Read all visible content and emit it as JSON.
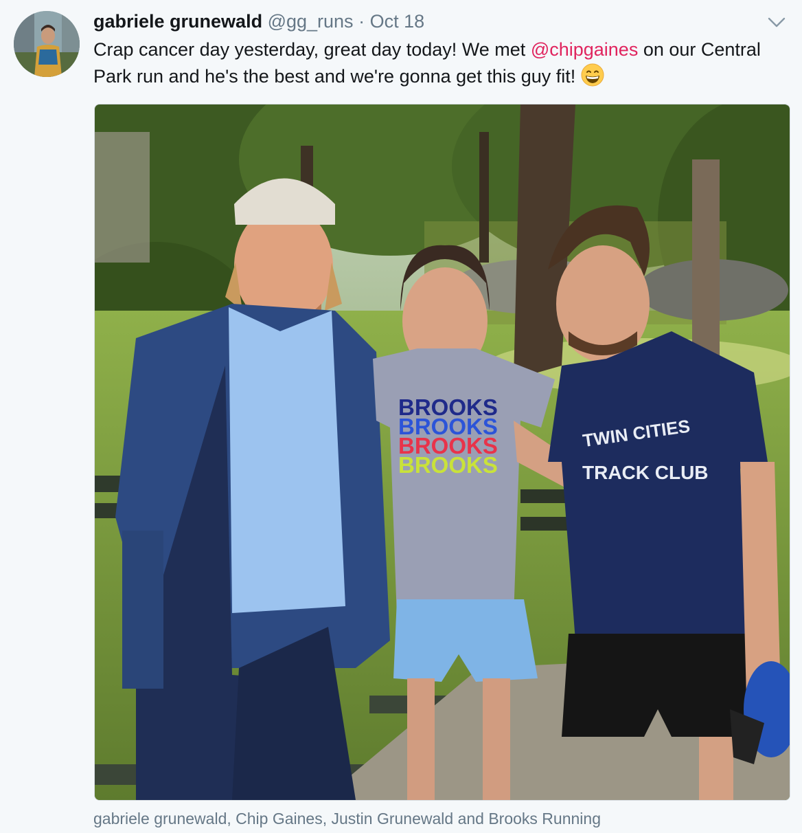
{
  "tweet": {
    "author_name": "gabriele grunewald",
    "author_handle": "@gg_runs",
    "separator": "·",
    "timestamp": "Oct 18",
    "text_before": "Crap cancer day yesterday, great day today! We met ",
    "mention": "@chipgaines",
    "text_after": " on our Central Park run and he's the best and we're gonna get this guy fit! ",
    "emoji": "grinning-face-with-smiling-eyes",
    "media_caption": "gabriele grunewald, Chip Gaines, Justin Grunewald and Brooks Running"
  },
  "photo": {
    "shirt_brand_lines": [
      "BROOKS",
      "BROOKS",
      "BROOKS",
      "BROOKS"
    ],
    "shirt_brand_colors": [
      "#1f2a8a",
      "#2c54d8",
      "#e8334a",
      "#c9e23a"
    ],
    "shirt2_line1": "TWIN CITIES",
    "shirt2_line2": "TRACK CLUB"
  },
  "colors": {
    "mention": "#e0245e",
    "secondary_text": "#657786",
    "background": "#f5f8fa"
  },
  "icons": {
    "menu": "chevron-down-icon"
  }
}
